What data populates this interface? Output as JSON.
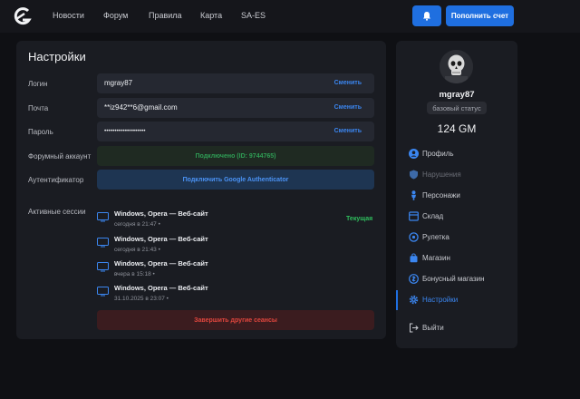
{
  "nav": {
    "links": [
      "Новости",
      "Форум",
      "Правила",
      "Карта",
      "SA-ES"
    ],
    "topup_label": "Пополнить счет"
  },
  "settings": {
    "title": "Настройки",
    "login": {
      "label": "Логин",
      "value": "mgray87",
      "action": "Сменить"
    },
    "email": {
      "label": "Почта",
      "value": "**iz942**6@gmail.com",
      "action": "Сменить"
    },
    "password": {
      "label": "Пароль",
      "value": "••••••••••••••••••••",
      "action": "Сменить"
    },
    "forum": {
      "label": "Форумный аккаунт",
      "value": "Подключено (ID: 9744765)"
    },
    "auth": {
      "label": "Аутентификатор",
      "button": "Подключить Google Authenticator"
    },
    "sessions": {
      "label": "Активные сессии",
      "current_label": "Текущая",
      "items": [
        {
          "title": "Windows, Opera — Веб-сайт",
          "time": "сегодня в 21:47 •"
        },
        {
          "title": "Windows, Opera — Веб-сайт",
          "time": "сегодня в 21:43 •"
        },
        {
          "title": "Windows, Opera — Веб-сайт",
          "time": "вчера в 15:18 •"
        },
        {
          "title": "Windows, Opera — Веб-сайт",
          "time": "31.10.2025 в 23:07 •"
        }
      ]
    },
    "end_sessions_label": "Завершить другие сеансы"
  },
  "profile": {
    "username": "mgray87",
    "status": "базовый статус",
    "balance": "124 GM",
    "menu": [
      {
        "label": "Профиль",
        "icon": "user-circle-icon",
        "state": "normal"
      },
      {
        "label": "Нарушения",
        "icon": "shield-icon",
        "state": "muted"
      },
      {
        "label": "Персонажи",
        "icon": "person-icon",
        "state": "normal"
      },
      {
        "label": "Склад",
        "icon": "box-icon",
        "state": "normal"
      },
      {
        "label": "Рулетка",
        "icon": "roulette-icon",
        "state": "normal"
      },
      {
        "label": "Магазин",
        "icon": "cart-icon",
        "state": "normal"
      },
      {
        "label": "Бонусный магазин",
        "icon": "gift-icon",
        "state": "normal"
      },
      {
        "label": "Настройки",
        "icon": "gear-icon",
        "state": "active"
      },
      {
        "label": "Выйти",
        "icon": "logout-icon",
        "state": "normal"
      }
    ]
  },
  "colors": {
    "accent": "#1f6fe0",
    "success": "#2fbf5e",
    "danger": "#e0463e",
    "card": "#1a1c22",
    "background": "#0f1014"
  }
}
